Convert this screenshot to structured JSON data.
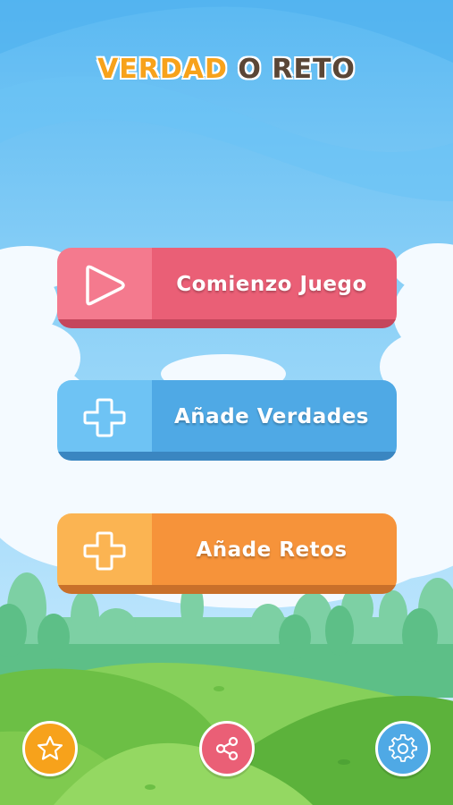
{
  "title": {
    "word1": "VERDAD",
    "word2": "O",
    "word3": "RETO"
  },
  "menu": {
    "start_label": "Comienzo Juego",
    "add_truths_label": "Añade Verdades",
    "add_dares_label": "Añade Retos"
  },
  "bottom_bar": {
    "buttons": [
      {
        "icon": "star-icon",
        "color": "#f7a21b"
      },
      {
        "icon": "share-icon",
        "color": "#ea5f76"
      },
      {
        "icon": "gear-icon",
        "color": "#4fa9e5"
      }
    ]
  },
  "colors": {
    "sky": "#8fd2f7",
    "start": "#ea5f76",
    "truths": "#4fa9e5",
    "dares": "#f6933a",
    "title_accent": "#f7a21b",
    "title_dark": "#5a4636"
  }
}
